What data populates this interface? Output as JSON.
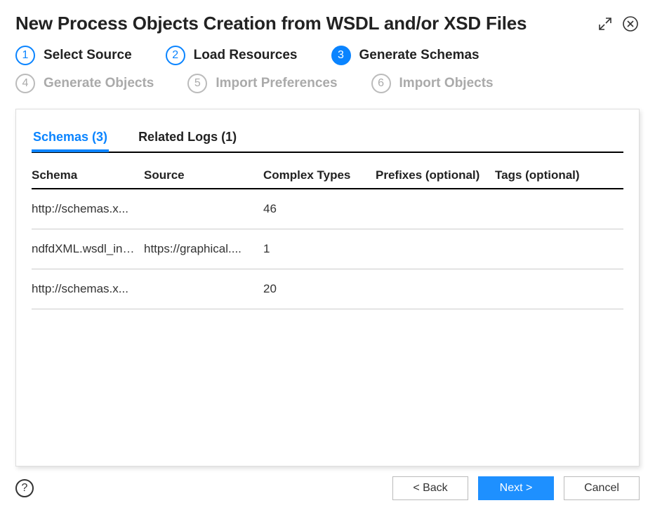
{
  "dialog": {
    "title": "New Process Objects Creation from WSDL and/or XSD Files"
  },
  "steps": [
    {
      "num": "1",
      "label": "Select Source",
      "state": "done"
    },
    {
      "num": "2",
      "label": "Load Resources",
      "state": "done"
    },
    {
      "num": "3",
      "label": "Generate Schemas",
      "state": "current"
    },
    {
      "num": "4",
      "label": "Generate Objects",
      "state": "future"
    },
    {
      "num": "5",
      "label": "Import Preferences",
      "state": "future"
    },
    {
      "num": "6",
      "label": "Import Objects",
      "state": "future"
    }
  ],
  "tabs": {
    "schemas": "Schemas (3)",
    "logs": "Related Logs (1)"
  },
  "table": {
    "headers": {
      "schema": "Schema",
      "source": "Source",
      "complex": "Complex Types",
      "prefix": "Prefixes (optional)",
      "tags": "Tags (optional)"
    },
    "rows": [
      {
        "schema": "http://schemas.x...",
        "source": "",
        "complex": "46",
        "prefix": "",
        "tags": ""
      },
      {
        "schema": "ndfdXML.wsdl_inli...",
        "source": "https://graphical....",
        "complex": "1",
        "prefix": "",
        "tags": ""
      },
      {
        "schema": "http://schemas.x...",
        "source": "",
        "complex": "20",
        "prefix": "",
        "tags": ""
      }
    ]
  },
  "buttons": {
    "back": "< Back",
    "next": "Next >",
    "cancel": "Cancel"
  }
}
